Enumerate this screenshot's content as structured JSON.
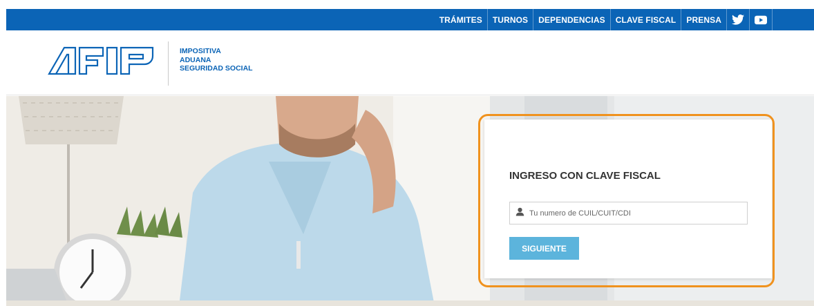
{
  "topnav": {
    "items": [
      "TRÁMITES",
      "TURNOS",
      "DEPENDENCIAS",
      "CLAVE FISCAL",
      "PRENSA"
    ],
    "icons": [
      "twitter-icon",
      "youtube-icon"
    ]
  },
  "header": {
    "logo_text": "AFIP",
    "tagline": [
      "IMPOSITIVA",
      "ADUANA",
      "SEGURIDAD SOCIAL"
    ]
  },
  "login": {
    "title": "INGRESO CON CLAVE FISCAL",
    "input_placeholder": "Tu numero de CUIL/CUIT/CDI",
    "button_label": "SIGUIENTE"
  },
  "colors": {
    "brand_blue": "#0b64b6",
    "button_blue": "#5cb4dc",
    "highlight_orange": "#f0921e"
  }
}
